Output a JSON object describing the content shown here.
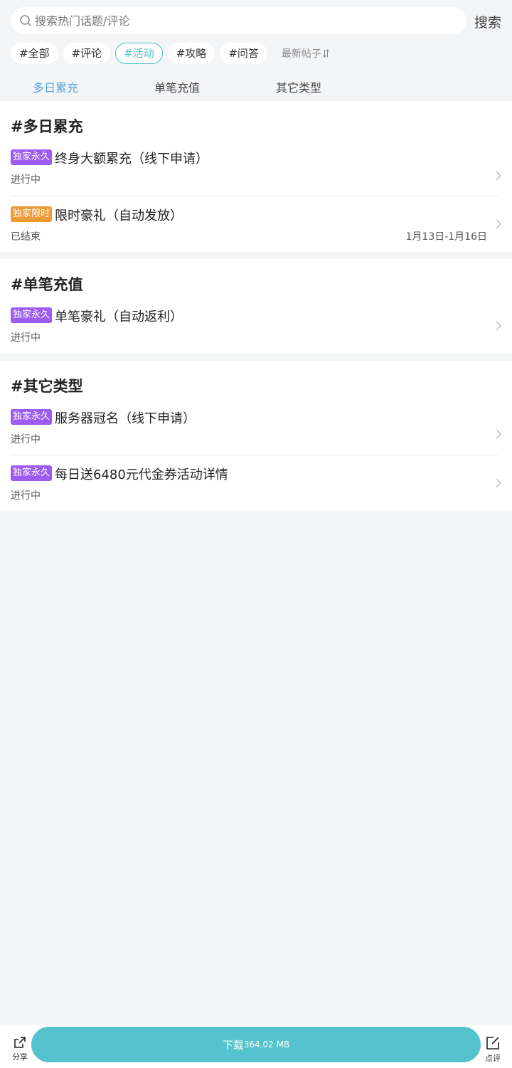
{
  "search": {
    "placeholder": "搜索热门话题/评论",
    "button_label": "搜索"
  },
  "chips": [
    {
      "label": "#全部",
      "active": false
    },
    {
      "label": "#评论",
      "active": false
    },
    {
      "label": "#活动",
      "active": true
    },
    {
      "label": "#攻略",
      "active": false
    },
    {
      "label": "#问答",
      "active": false
    }
  ],
  "sort_label": "最新帖子",
  "tabs": [
    {
      "label": "多日累充",
      "active": true
    },
    {
      "label": "单笔充值",
      "active": false
    },
    {
      "label": "其它类型",
      "active": false
    }
  ],
  "sections": [
    {
      "title": "#多日累充",
      "items": [
        {
          "badge": "独家永久",
          "badge_color": "#9e5bf0",
          "title": "终身大额累充（线下申请）",
          "status": "进行中",
          "date": ""
        },
        {
          "badge": "独家限时",
          "badge_color": "#f09a36",
          "title": "限时豪礼（自动发放）",
          "status": "已结束",
          "date": "1月13日-1月16日"
        }
      ]
    },
    {
      "title": "#单笔充值",
      "items": [
        {
          "badge": "独家永久",
          "badge_color": "#9e5bf0",
          "title": "单笔豪礼（自动返利）",
          "status": "进行中",
          "date": ""
        }
      ]
    },
    {
      "title": "#其它类型",
      "items": [
        {
          "badge": "独家永久",
          "badge_color": "#9e5bf0",
          "title": "服务器冠名（线下申请）",
          "status": "进行中",
          "date": ""
        },
        {
          "badge": "独家永久",
          "badge_color": "#9e5bf0",
          "title": "每日送6480元代金券活动详情",
          "status": "进行中",
          "date": ""
        }
      ]
    }
  ],
  "bottom_bar": {
    "share_label": "分享",
    "download_label": "下载",
    "download_size": "364.02 MB",
    "review_label": "点评"
  },
  "colors": {
    "accent": "#54c3cd",
    "tab_active": "#57a4e0",
    "badge_permanent": "#9e5bf0",
    "badge_limited": "#f09a36"
  }
}
